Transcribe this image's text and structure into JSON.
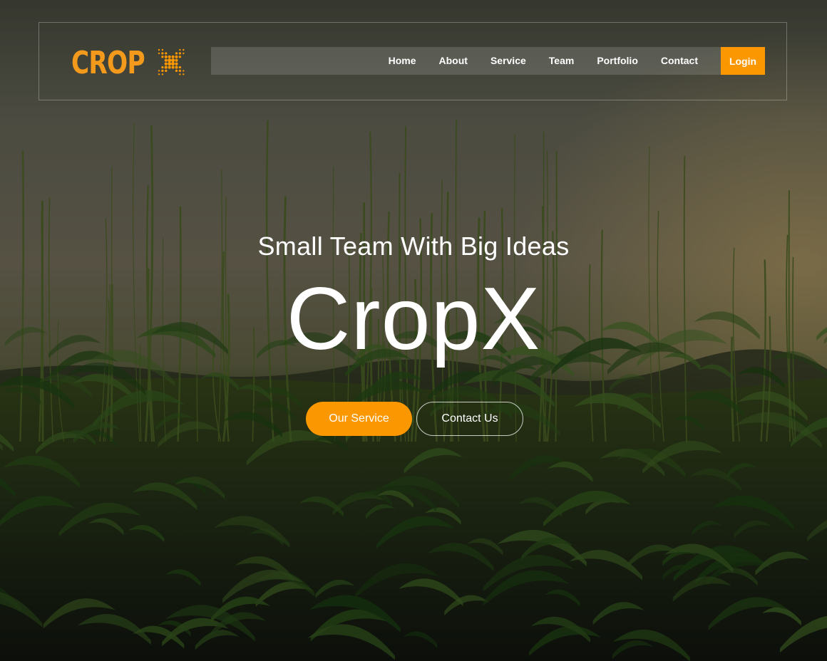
{
  "brand": {
    "logo_text": "CROP",
    "accent_color": "#fb9700",
    "logo_icon": "x-dots-icon"
  },
  "nav": {
    "items": [
      {
        "label": "Home"
      },
      {
        "label": "About"
      },
      {
        "label": "Service"
      },
      {
        "label": "Team"
      },
      {
        "label": "Portfolio"
      },
      {
        "label": "Contact"
      }
    ],
    "login_label": "Login"
  },
  "hero": {
    "subtitle": "Small Team With Big Ideas",
    "title": "CropX",
    "primary_button": "Our Service",
    "secondary_button": "Contact Us",
    "background": "corn-field-sunset-image"
  }
}
